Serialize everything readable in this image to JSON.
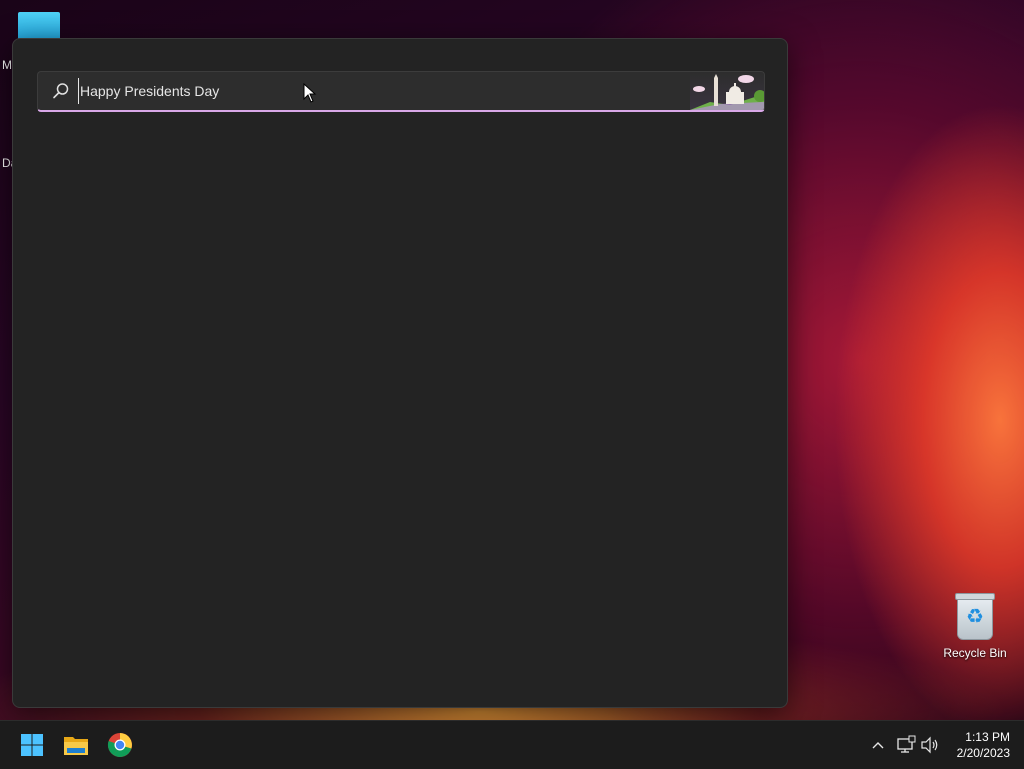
{
  "desktop": {
    "peek_letters": [
      "M",
      "Da"
    ],
    "recycle_bin_label": "Recycle Bin"
  },
  "search": {
    "query": "Happy Presidents Day",
    "accent_color": "#d9a8e8",
    "highlight_icon": "presidents-day-capitol-illustration"
  },
  "taskbar": {
    "apps": [
      "start-menu",
      "file-explorer",
      "google-chrome"
    ],
    "tray_icons": [
      "chevron-up-icon",
      "network-icon",
      "volume-icon"
    ],
    "time": "1:13 PM",
    "date": "2/20/2023"
  }
}
